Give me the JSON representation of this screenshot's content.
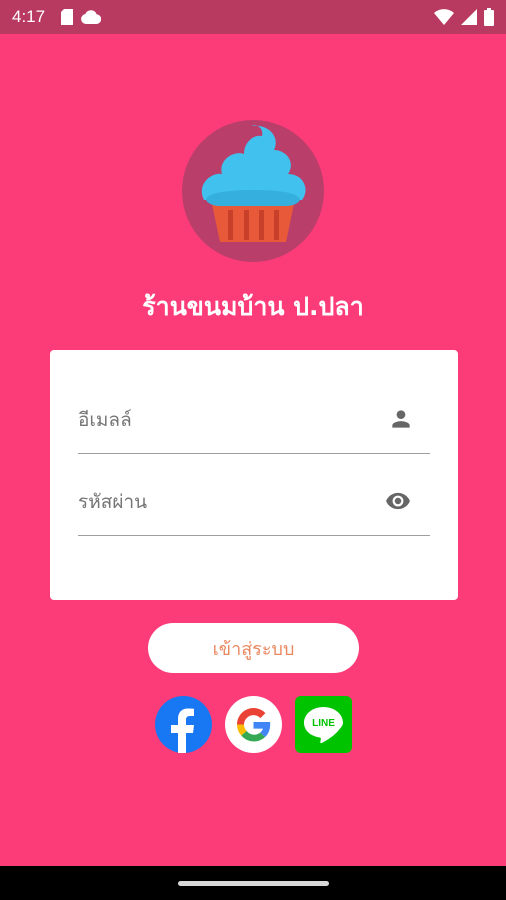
{
  "status_bar": {
    "time": "4:17"
  },
  "app": {
    "title": "ร้านขนมบ้าน ป.ปลา"
  },
  "form": {
    "email_placeholder": "อีเมลล์",
    "password_placeholder": "รหัสผ่าน",
    "login_label": "เข้าสู่ระบบ"
  },
  "social_logins": [
    {
      "provider": "facebook",
      "icon": "facebook-icon"
    },
    {
      "provider": "google",
      "icon": "google-icon"
    },
    {
      "provider": "line",
      "icon": "line-icon",
      "label": "LINE"
    }
  ],
  "colors": {
    "background": "#fb3c78",
    "status_bar": "#b93a61",
    "button_text": "#e98860",
    "facebook": "#1877f2",
    "line": "#00c300"
  }
}
